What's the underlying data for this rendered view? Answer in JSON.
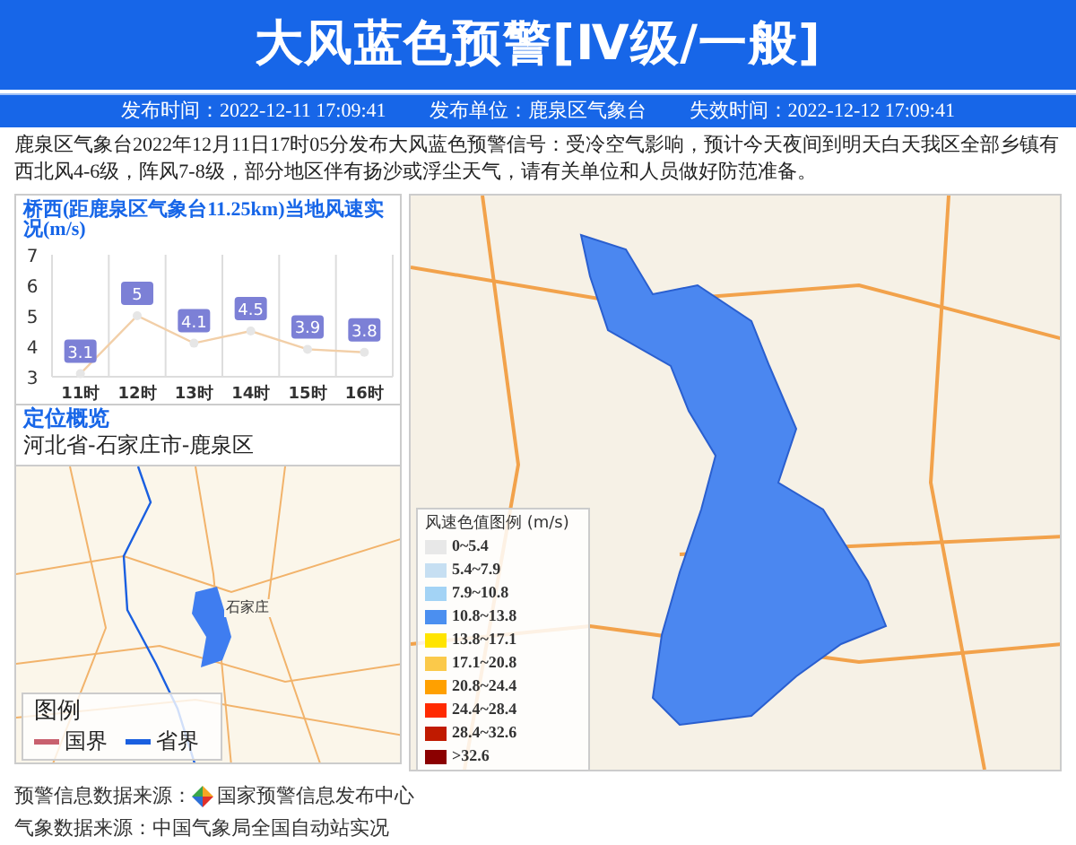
{
  "header": {
    "title": "大风蓝色预警[Ⅳ级/一般]"
  },
  "info_bar": [
    "发布时间：2022-12-11 17:09:41",
    "发布单位：鹿泉区气象台",
    "失效时间：2022-12-12 17:09:41"
  ],
  "description": "鹿泉区气象台2022年12月11日17时05分发布大风蓝色预警信号：受冷空气影响，预计今天夜间到明天白天我区全部乡镇有西北风4-6级，阵风7-8级，部分地区伴有扬沙或浮尘天气，请有关单位和人员做好防范准备。",
  "station_panel": {
    "title": "桥西(距鹿泉区气象台11.25km)当地风速实况(m/s)",
    "chart_data": {
      "type": "line",
      "categories": [
        "11时",
        "12时",
        "13时",
        "14时",
        "15时",
        "16时"
      ],
      "series": [
        {
          "color": "#f2cfa8",
          "marker": true,
          "values": [
            3.1,
            5,
            4.1,
            4.5,
            3.9,
            3.8
          ]
        }
      ],
      "ylim": [
        3,
        7
      ],
      "yticks": [
        3,
        4,
        5,
        6,
        7
      ],
      "data_labels": true
    }
  },
  "location": {
    "heading": "定位概览",
    "path": "河北省-石家庄市-鹿泉区"
  },
  "overview_legend": {
    "title": "图例",
    "items": [
      {
        "label": "国界",
        "color": "#c8606e"
      },
      {
        "label": "省界",
        "color": "#1a5fe0"
      }
    ]
  },
  "overview_map": {
    "city_label": "石家庄"
  },
  "wind_legend": {
    "title": "风速色值图例 (m/s)",
    "items": [
      {
        "label": "0~5.4",
        "color": "#e8e8e8"
      },
      {
        "label": "5.4~7.9",
        "color": "#c6dff2"
      },
      {
        "label": "7.9~10.8",
        "color": "#a3d3f5"
      },
      {
        "label": "10.8~13.8",
        "color": "#4b8ff0"
      },
      {
        "label": "13.8~17.1",
        "color": "#ffe400"
      },
      {
        "label": "17.1~20.8",
        "color": "#fbc94a"
      },
      {
        "label": "20.8~24.4",
        "color": "#ffa000"
      },
      {
        "label": "24.4~28.4",
        "color": "#ff2a00"
      },
      {
        "label": "28.4~32.6",
        "color": "#c01a00"
      },
      {
        "label": ">32.6",
        "color": "#8b0000"
      }
    ]
  },
  "footer": [
    {
      "kind": "logo",
      "label": "预警信息数据来源：",
      "value": "国家预警信息发布中心"
    },
    {
      "kind": "plain",
      "label": "气象数据来源：",
      "value": "中国气象局全国自动站实况"
    }
  ]
}
